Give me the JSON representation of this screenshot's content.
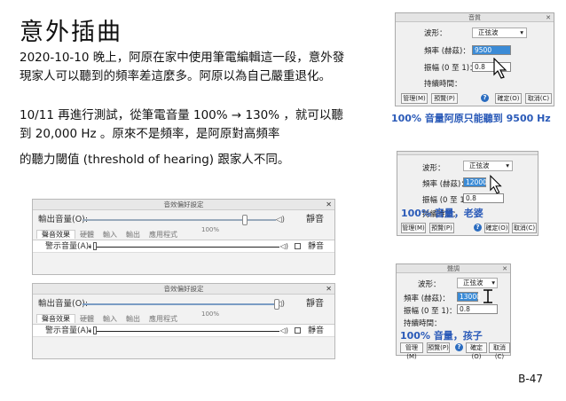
{
  "title": "意外插曲",
  "paragraphs": {
    "p1": "2020-10-10 晚上，阿原在家中使用筆電編輯這一段，意外發現家人可以聽到的頻率差這麼多。阿原以為自己嚴重退化。",
    "p2": "10/11 再進行測試，從筆電音量 100% → 130% ，就可以聽到 20,000 Hz 。原來不是頻率，是阿原對高頻率",
    "p3": "的聽力閾值 (threshold of hearing) 跟家人不同。"
  },
  "page_number": "B-47",
  "pref_panels": [
    {
      "window_title": "音效偏好設定",
      "output_label": "輸出音量(O):",
      "output_value": "100%",
      "mute_label": "靜音",
      "tabs": [
        "聲音效果",
        "硬體",
        "輸入",
        "輸出",
        "應用程式"
      ],
      "alert_label": "警示音量(A):",
      "alert_mute": "靜音",
      "output_level": 0.62
    },
    {
      "window_title": "音效偏好設定",
      "output_label": "輸出音量(O):",
      "output_value": "100%",
      "mute_label": "靜音",
      "tabs": [
        "聲音效果",
        "硬體",
        "輸入",
        "輸出",
        "應用程式"
      ],
      "alert_label": "警示音量(A):",
      "alert_mute": "靜音",
      "output_level": 0.98
    }
  ],
  "dialogs": [
    {
      "window_title": "音質",
      "waveform_label": "波形：",
      "waveform_value": "正弦波",
      "freq_label": "頻率 (赫茲)：",
      "freq_value": "9500",
      "amp_label": "振幅 (0 至 1)：",
      "amp_value": "0.8",
      "duration_label": "持續時間：",
      "buttons": [
        "管理(M)",
        "預覽(P)",
        "確定(O)",
        "取消(C)"
      ],
      "caption": "100% 音量阿原只能聽到 9500 Hz"
    },
    {
      "window_title": "",
      "waveform_label": "波形：",
      "waveform_value": "正弦波",
      "freq_label": "頻率 (赫茲)：",
      "freq_value": "12000",
      "amp_label": "振幅 (0 至 1)：",
      "amp_value": "0.8",
      "duration_label": "持續時間：",
      "buttons": [
        "管理(M)",
        "預覽(P)",
        "確定(O)",
        "取消(C)"
      ],
      "caption": "100% 音量，老婆"
    },
    {
      "window_title": "聲調",
      "waveform_label": "波形：",
      "waveform_value": "正弦波",
      "freq_label": "頻率 (赫茲)：",
      "freq_value": "13000",
      "amp_label": "振幅 (0 至 1)：",
      "amp_value": "0.8",
      "duration_label": "持續時間：",
      "buttons": [
        "管理(M)",
        "預覽(P)",
        "確定(O)",
        "取消(C)"
      ],
      "caption": "100% 音量，孩子"
    }
  ]
}
